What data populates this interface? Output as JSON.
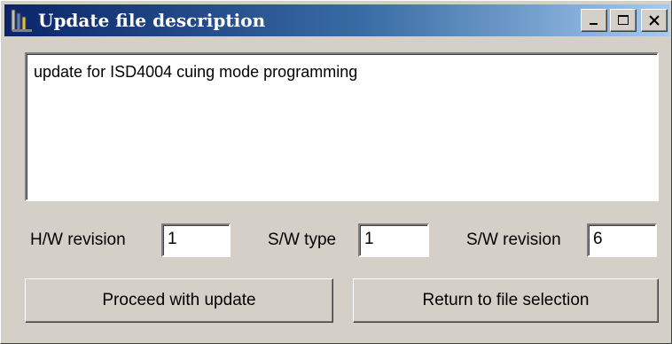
{
  "window": {
    "title": "Update file description",
    "controls": {
      "minimize_icon": "minimize-icon",
      "maximize_icon": "maximize-icon",
      "close_icon": "close-icon"
    }
  },
  "description": {
    "text": "update for ISD4004 cuing mode programming"
  },
  "fields": {
    "hw_revision": {
      "label": "H/W revision",
      "value": "1"
    },
    "sw_type": {
      "label": "S/W type",
      "value": "1"
    },
    "sw_revision": {
      "label": "S/W revision",
      "value": "6"
    }
  },
  "buttons": {
    "proceed": "Proceed with update",
    "return": "Return to file selection"
  },
  "colors": {
    "titlebar_start": "#0a246a",
    "titlebar_end": "#a6caf0",
    "window_bg": "#d4d0c8"
  }
}
